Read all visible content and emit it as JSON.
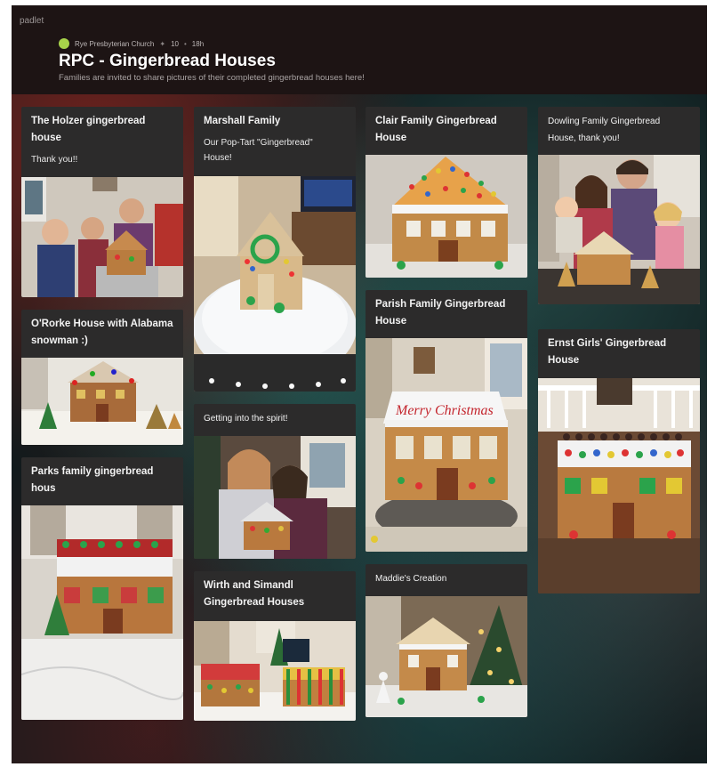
{
  "app": {
    "brand": "padlet"
  },
  "board": {
    "owner": "Rye Presbyterian Church",
    "likes": "10",
    "age": "18h",
    "title": "RPC - Gingerbread Houses",
    "subtitle": "Families are invited to share pictures of their completed gingerbread houses here!"
  },
  "posts": {
    "holzer": {
      "title": "The Holzer gingerbread house",
      "body": "Thank you!!"
    },
    "marshall": {
      "title": "Marshall Family",
      "body": "Our Pop-Tart \"Gingerbread\" House!"
    },
    "clair": {
      "title": "Clair Family Gingerbread House"
    },
    "dowling": {
      "title": "Dowling Family Gingerbread House, thank you!"
    },
    "ororke": {
      "title": "O'Rorke House with Alabama snowman :)"
    },
    "parks": {
      "title": "Parks family gingerbread hous"
    },
    "spirit": {
      "title": "Getting into the spirit!"
    },
    "wirth": {
      "title": "Wirth and Simandl Gingerbread Houses"
    },
    "parish": {
      "title": "Parish Family Gingerbread House"
    },
    "maddie": {
      "title": "Maddie's Creation"
    },
    "ernst": {
      "title": "Ernst Girls' Gingerbread House"
    }
  },
  "photo_labels": {
    "merry": "Merry Christmas"
  },
  "colors": {
    "card": "#2c2b2b",
    "header": "#1d1414",
    "accent": "#a7d34a"
  }
}
